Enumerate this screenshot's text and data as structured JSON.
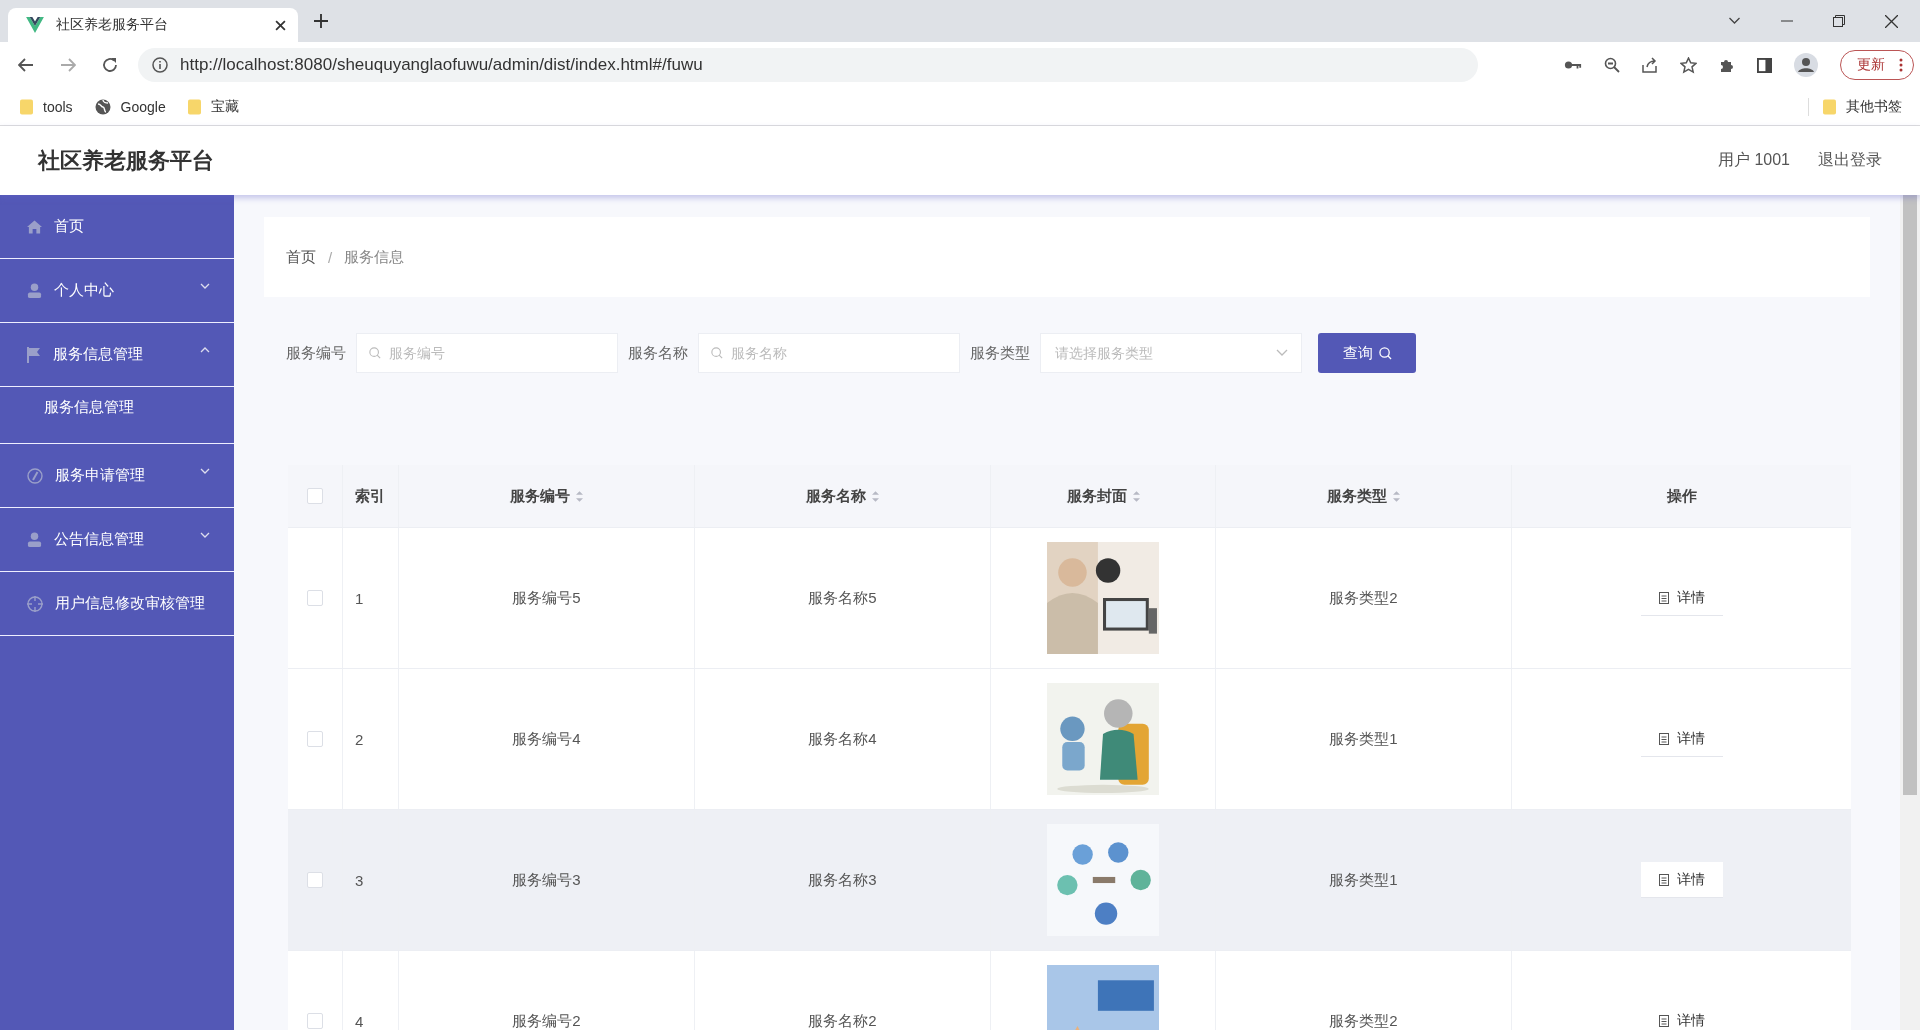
{
  "browser": {
    "tab_title": "社区养老服务平台",
    "url": "http://localhost:8080/sheuquyanglaofuwu/admin/dist/index.html#/fuwu",
    "update_button": "更新",
    "bookmarks": [
      "tools",
      "Google",
      "宝藏"
    ],
    "other_bookmarks": "其他书签"
  },
  "header": {
    "title": "社区养老服务平台",
    "user": "用户 1001",
    "logout": "退出登录"
  },
  "sidebar": {
    "items": [
      {
        "label": "首页"
      },
      {
        "label": "个人中心",
        "expanded": false
      },
      {
        "label": "服务信息管理",
        "expanded": true,
        "children": [
          {
            "label": "服务信息管理"
          }
        ]
      },
      {
        "label": "服务申请管理",
        "expanded": false
      },
      {
        "label": "公告信息管理",
        "expanded": false
      },
      {
        "label": "用户信息修改审核管理"
      }
    ]
  },
  "breadcrumb": {
    "items": [
      "首页",
      "服务信息"
    ],
    "separator": "/"
  },
  "search": {
    "fields": [
      {
        "label": "服务编号",
        "placeholder": "服务编号",
        "kind": "text"
      },
      {
        "label": "服务名称",
        "placeholder": "服务名称",
        "kind": "text"
      },
      {
        "label": "服务类型",
        "placeholder": "请选择服务类型",
        "kind": "select"
      }
    ],
    "button": "查询"
  },
  "table": {
    "select_all": {
      "checked": false
    },
    "columns": [
      {
        "label": "索引",
        "sortable": false
      },
      {
        "label": "服务编号",
        "sortable": true
      },
      {
        "label": "服务名称",
        "sortable": true
      },
      {
        "label": "服务封面",
        "sortable": true
      },
      {
        "label": "服务类型",
        "sortable": true
      },
      {
        "label": "操作",
        "sortable": false
      }
    ],
    "rows": [
      {
        "checked": false,
        "highlighted": false,
        "index": "1",
        "code": "服务编号5",
        "name": "服务名称5",
        "type": "服务类型2",
        "action": "详情"
      },
      {
        "checked": false,
        "highlighted": false,
        "index": "2",
        "code": "服务编号4",
        "name": "服务名称4",
        "type": "服务类型1",
        "action": "详情"
      },
      {
        "checked": false,
        "highlighted": true,
        "index": "3",
        "code": "服务编号3",
        "name": "服务名称3",
        "type": "服务类型1",
        "action": "详情"
      },
      {
        "checked": false,
        "highlighted": false,
        "index": "4",
        "code": "服务编号2",
        "name": "服务名称2",
        "type": "服务类型2",
        "action": "详情"
      }
    ]
  }
}
